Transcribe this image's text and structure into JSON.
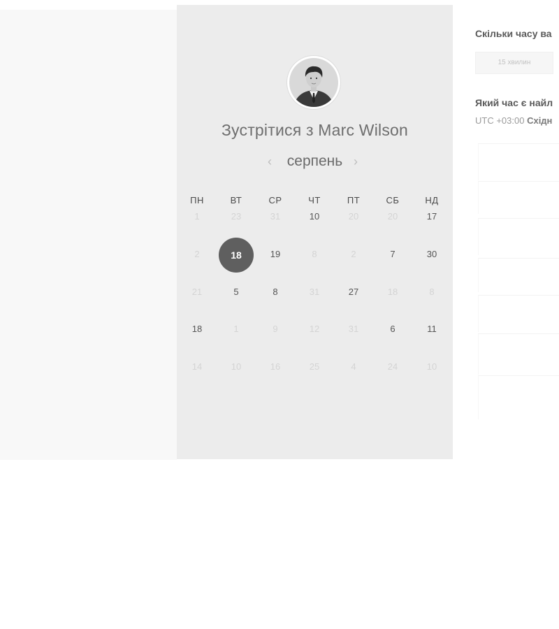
{
  "booking": {
    "meet_title": "Зустрітися з Marc Wilson",
    "month": "серпень",
    "prev_icon": "chevron-left-icon",
    "next_icon": "chevron-right-icon"
  },
  "calendar": {
    "weekdays": [
      "ПН",
      "ВТ",
      "СР",
      "ЧТ",
      "ПТ",
      "СБ",
      "НД"
    ],
    "weeks": [
      [
        {
          "d": "1",
          "s": "dim"
        },
        {
          "d": "23",
          "s": "dim"
        },
        {
          "d": "31",
          "s": "dim"
        },
        {
          "d": "10",
          "s": "on"
        },
        {
          "d": "20",
          "s": "dim"
        },
        {
          "d": "20",
          "s": "dim"
        },
        {
          "d": "17",
          "s": "on"
        }
      ],
      [
        {
          "d": "2",
          "s": "dim"
        },
        {
          "d": "18",
          "s": "sel"
        },
        {
          "d": "19",
          "s": "on"
        },
        {
          "d": "8",
          "s": "dim"
        },
        {
          "d": "2",
          "s": "dim"
        },
        {
          "d": "7",
          "s": "on"
        },
        {
          "d": "30",
          "s": "on"
        }
      ],
      [
        {
          "d": "21",
          "s": "dim"
        },
        {
          "d": "5",
          "s": "on"
        },
        {
          "d": "8",
          "s": "on"
        },
        {
          "d": "31",
          "s": "dim"
        },
        {
          "d": "27",
          "s": "on"
        },
        {
          "d": "18",
          "s": "dim"
        },
        {
          "d": "8",
          "s": "dim"
        }
      ],
      [
        {
          "d": "18",
          "s": "on"
        },
        {
          "d": "1",
          "s": "dim"
        },
        {
          "d": "9",
          "s": "dim"
        },
        {
          "d": "12",
          "s": "dim"
        },
        {
          "d": "31",
          "s": "dim"
        },
        {
          "d": "6",
          "s": "on"
        },
        {
          "d": "11",
          "s": "on"
        }
      ],
      [
        {
          "d": "14",
          "s": "dim"
        },
        {
          "d": "10",
          "s": "dim"
        },
        {
          "d": "16",
          "s": "dim"
        },
        {
          "d": "25",
          "s": "dim"
        },
        {
          "d": "4",
          "s": "dim"
        },
        {
          "d": "24",
          "s": "dim"
        },
        {
          "d": "10",
          "s": "dim"
        }
      ]
    ]
  },
  "right_panel": {
    "question_duration": "Скільки часу ва",
    "duration_option": "15 хвилин",
    "question_time": "Який час є найл",
    "timezone_offset": "UTC +03:00",
    "timezone_name": "Східн"
  }
}
